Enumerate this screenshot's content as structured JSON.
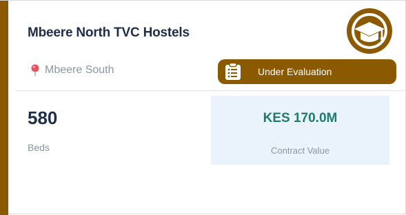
{
  "project": {
    "title": "Mbeere North TVC Hostels",
    "logo_icon": "graduation-cap-icon",
    "location_icon": "map-pin-icon",
    "location": "Mbeere South",
    "status": {
      "icon": "clipboard-list-icon",
      "label": "Under Evaluation"
    },
    "stats": {
      "beds_value": "580",
      "beds_label": "Beds",
      "contract_value": "KES 170.0M",
      "contract_label": "Contract Value"
    }
  },
  "colors": {
    "accent": "#8b5a00",
    "title": "#1c2e4a",
    "muted": "#8a96a3",
    "contract_value": "#1e7a6d",
    "contract_bg": "#eaf3fb",
    "pin": "#e8505b"
  }
}
